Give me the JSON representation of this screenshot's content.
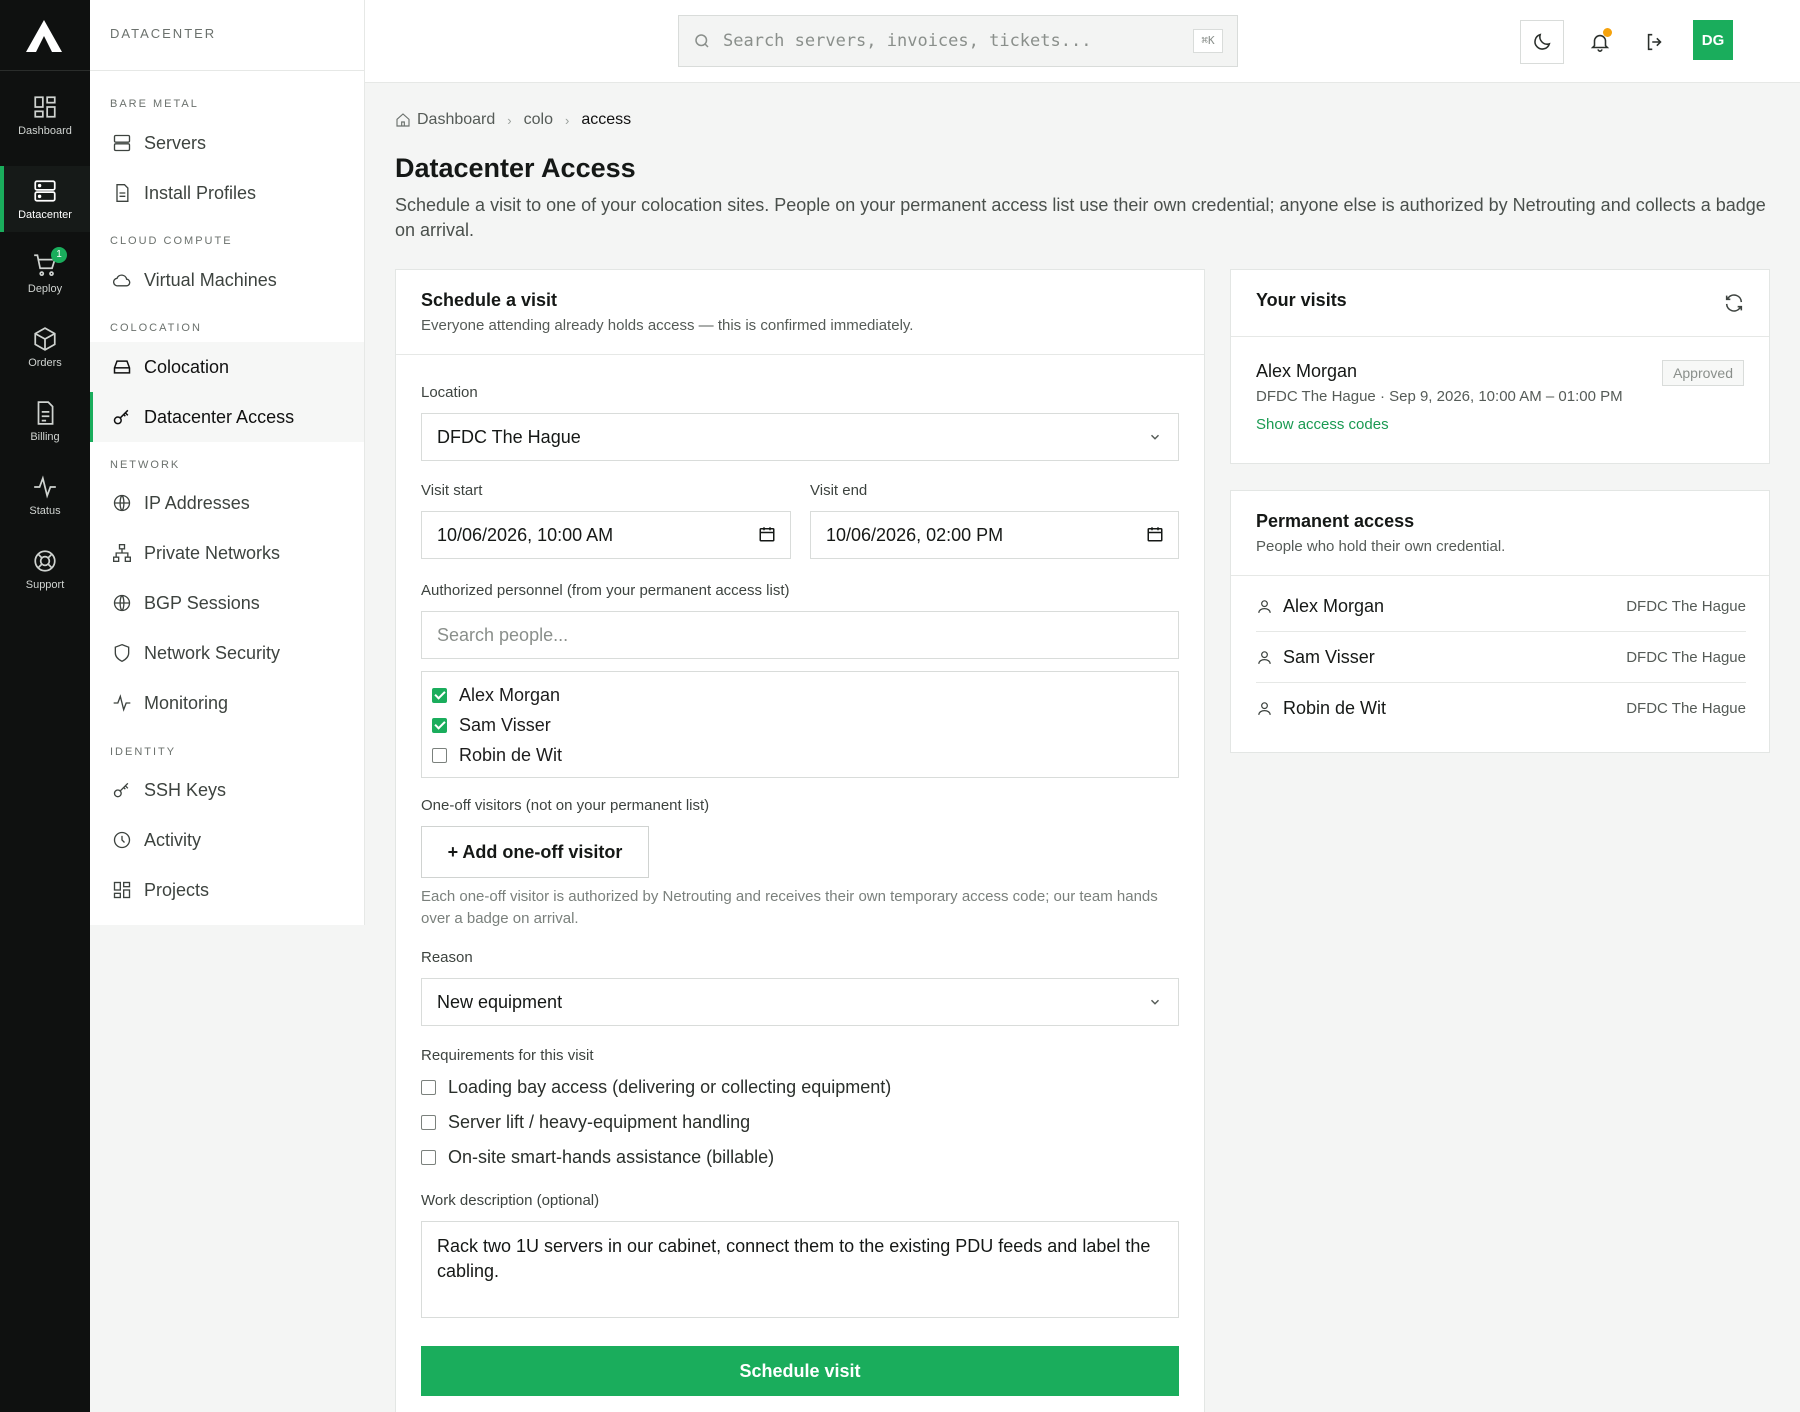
{
  "rail": {
    "items": [
      {
        "label": "Dashboard"
      },
      {
        "label": "Datacenter"
      },
      {
        "label": "Deploy",
        "badge": "1"
      },
      {
        "label": "Orders"
      },
      {
        "label": "Billing"
      },
      {
        "label": "Status"
      },
      {
        "label": "Support"
      }
    ],
    "active": "Datacenter"
  },
  "sidebar": {
    "title": "DATACENTER",
    "groups": {
      "bare_metal": "BARE METAL",
      "cloud_compute": "CLOUD COMPUTE",
      "colocation": "COLOCATION",
      "network": "NETWORK",
      "identity": "IDENTITY"
    },
    "items": {
      "servers": "Servers",
      "install_profiles": "Install Profiles",
      "virtual_machines": "Virtual Machines",
      "colocation": "Colocation",
      "datacenter_access": "Datacenter Access",
      "ip_addresses": "IP Addresses",
      "private_networks": "Private Networks",
      "bgp_sessions": "BGP Sessions",
      "network_security": "Network Security",
      "monitoring": "Monitoring",
      "ssh_keys": "SSH Keys",
      "activity": "Activity",
      "projects": "Projects"
    }
  },
  "topbar": {
    "search_placeholder": "Search servers, invoices, tickets...",
    "shortcut": "⌘K",
    "avatar_initials": "DG",
    "notification_dot_color": "#f5a20c"
  },
  "breadcrumb": [
    "Dashboard",
    "colo",
    "access"
  ],
  "page": {
    "title": "Datacenter Access",
    "description": "Schedule a visit to one of your colocation sites. People on your permanent access list use their own credential; anyone else is authorized by Netrouting and collects a badge on arrival."
  },
  "schedule": {
    "title": "Schedule a visit",
    "subtitle": "Everyone attending already holds access — this is confirmed immediately.",
    "location_label": "Location",
    "location_value": "DFDC The Hague",
    "visit_start_label": "Visit start",
    "visit_start_value": "10/06/2026, 10:00  AM",
    "visit_end_label": "Visit end",
    "visit_end_value": "10/06/2026, 02:00  PM",
    "personnel_label": "Authorized personnel (from your permanent access list)",
    "people_search_placeholder": "Search people...",
    "people": [
      {
        "name": "Alex Morgan",
        "checked": true
      },
      {
        "name": "Sam Visser",
        "checked": true
      },
      {
        "name": "Robin de Wit",
        "checked": false
      }
    ],
    "oneoff_label": "One-off visitors (not on your permanent list)",
    "add_visitor_label": "+ Add one-off visitor",
    "oneoff_help": "Each one-off visitor is authorized by Netrouting and receives their own temporary access code; our team hands over a badge on arrival.",
    "reason_label": "Reason",
    "reason_value": "New equipment",
    "requirements_label": "Requirements for this visit",
    "requirements": [
      {
        "label": "Loading bay access (delivering or collecting equipment)",
        "checked": false
      },
      {
        "label": "Server lift / heavy-equipment handling",
        "checked": false
      },
      {
        "label": "On-site smart-hands assistance (billable)",
        "checked": false
      }
    ],
    "work_label": "Work description (optional)",
    "work_value": "Rack two 1U servers in our cabinet, connect them to the existing PDU feeds and label the cabling.",
    "submit_label": "Schedule visit"
  },
  "visits": {
    "title": "Your visits",
    "items": [
      {
        "name": "Alex Morgan",
        "meta": "DFDC The Hague · Sep 9, 2026, 10:00 AM – 01:00 PM",
        "link": "Show access codes",
        "status": "Approved"
      }
    ]
  },
  "permanent": {
    "title": "Permanent access",
    "subtitle": "People who hold their own credential.",
    "people": [
      {
        "name": "Alex Morgan",
        "location": "DFDC The Hague"
      },
      {
        "name": "Sam Visser",
        "location": "DFDC The Hague"
      },
      {
        "name": "Robin de Wit",
        "location": "DFDC The Hague"
      }
    ]
  },
  "colors": {
    "accent": "#1aad5c",
    "rail_bg": "#0f1110"
  }
}
